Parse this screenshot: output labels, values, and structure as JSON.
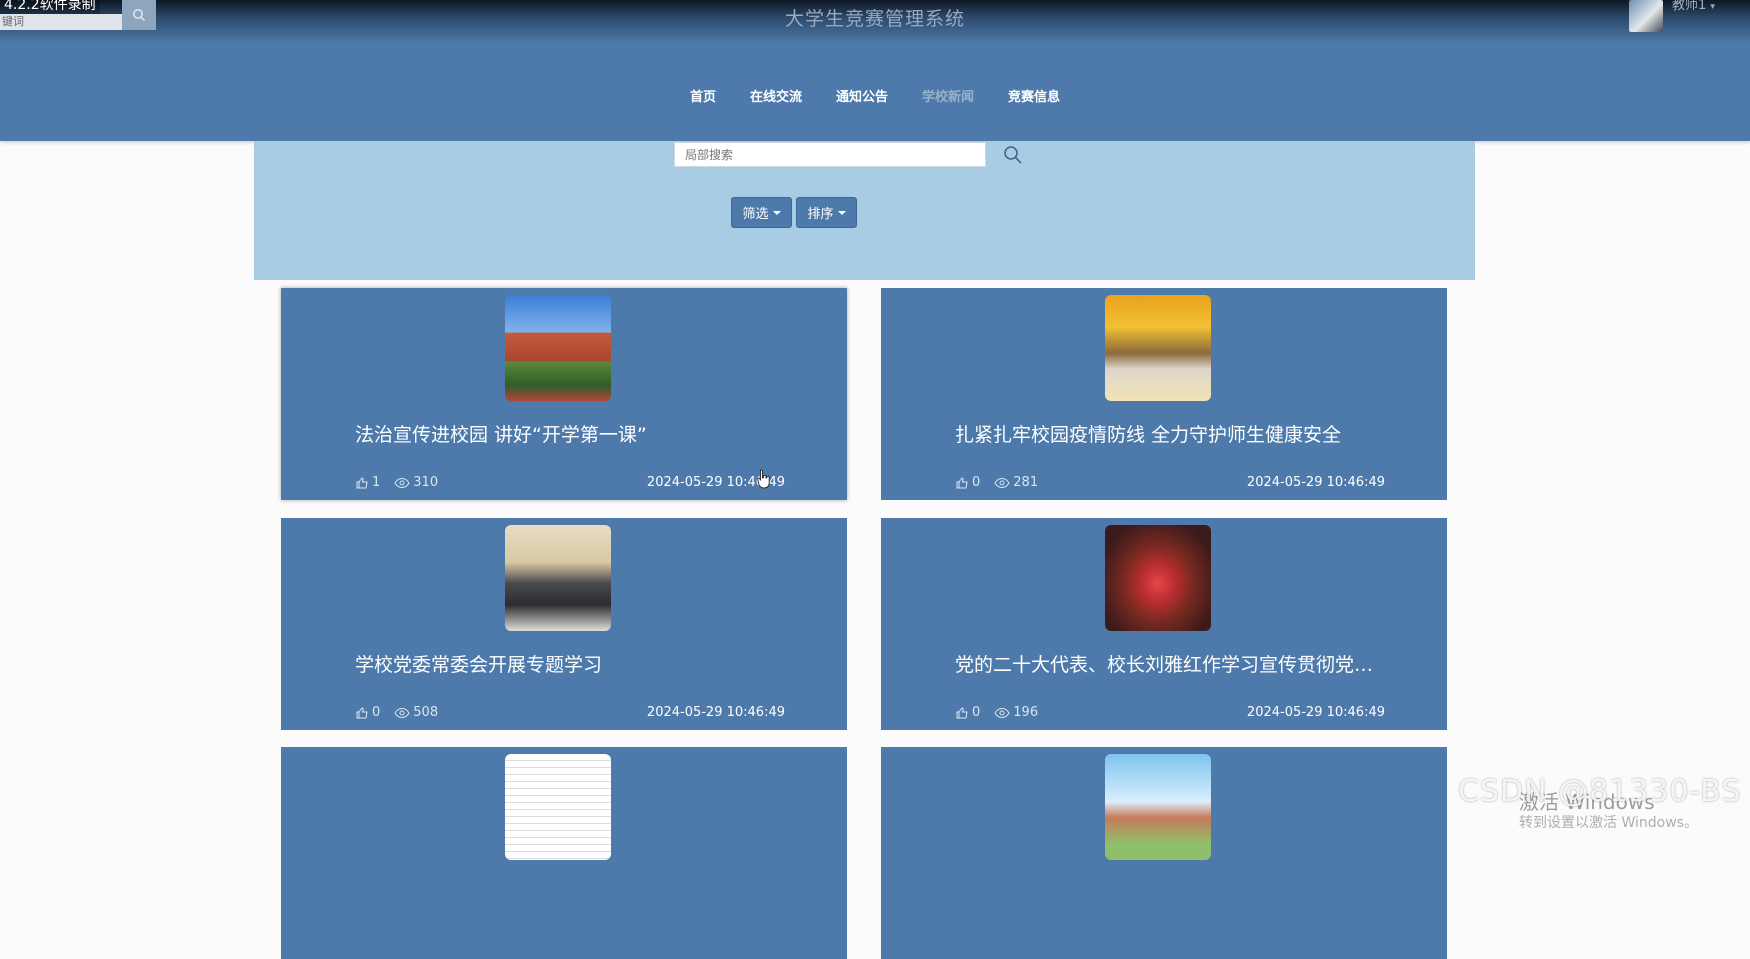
{
  "recorder": {
    "label": "4.2.2软件录制"
  },
  "top_search": {
    "placeholder": "键词"
  },
  "site": {
    "title": "大学生竞赛管理系统"
  },
  "user": {
    "name": "教师1"
  },
  "nav": {
    "items": [
      {
        "label": "首页",
        "active": false
      },
      {
        "label": "在线交流",
        "active": false
      },
      {
        "label": "通知公告",
        "active": false
      },
      {
        "label": "学校新闻",
        "active": true
      },
      {
        "label": "竞赛信息",
        "active": false
      }
    ]
  },
  "filter": {
    "search_placeholder": "局部搜索",
    "filter_label": "筛选",
    "sort_label": "排序"
  },
  "news": [
    {
      "title": "法治宣传进校园 讲好“开学第一课”",
      "likes": "1",
      "views": "310",
      "date": "2024-05-29 10:46:49",
      "image": "campus-building"
    },
    {
      "title": "扎紧扎牢校园疫情防线 全力守护师生健康安全",
      "likes": "0",
      "views": "281",
      "date": "2024-05-29 10:46:49",
      "image": "campus-gate"
    },
    {
      "title": "学校党委常委会开展专题学习",
      "likes": "0",
      "views": "508",
      "date": "2024-05-29 10:46:49",
      "image": "meeting-room"
    },
    {
      "title": "党的二十大代表、校长刘雅红作学习宣传贯彻党的…",
      "likes": "0",
      "views": "196",
      "date": "2024-05-29 10:46:49",
      "image": "auditorium"
    },
    {
      "title": "",
      "likes": "",
      "views": "",
      "date": "",
      "image": "document-table"
    },
    {
      "title": "",
      "likes": "",
      "views": "",
      "date": "",
      "image": "sky-building"
    }
  ],
  "watermarks": {
    "csdn": "CSDN @81330-BS",
    "windows_line1": "激活 Windows",
    "windows_line2": "转到设置以激活 Windows。"
  },
  "colors": {
    "nav_bg": "#4e7aab",
    "panel_bg": "#a9cce5",
    "card_bg": "#4e7aab",
    "active_nav": "#9ab0c8"
  }
}
